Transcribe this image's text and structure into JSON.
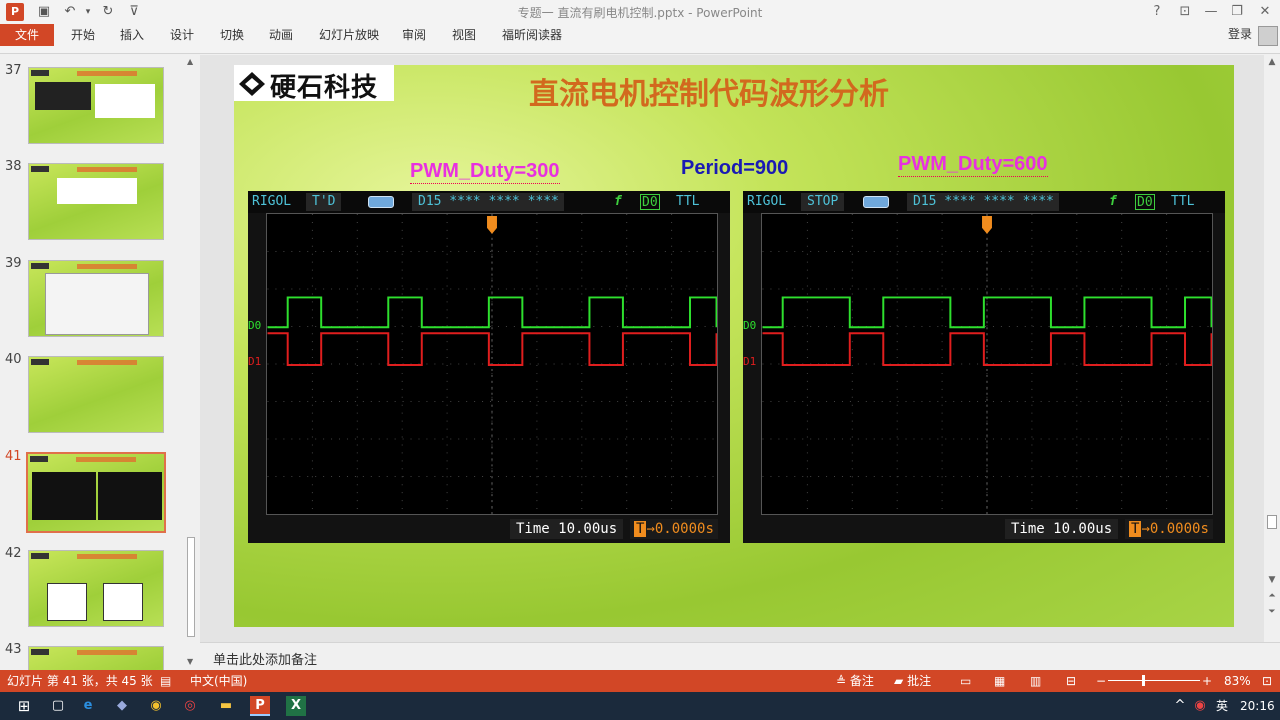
{
  "window": {
    "title": "专题一 直流有刷电机控制.pptx - PowerPoint",
    "quick_access": [
      "save-icon",
      "undo-icon",
      "redo-icon",
      "customize-icon"
    ],
    "controls": [
      "?",
      "⊡",
      "—",
      "❐",
      "✕"
    ]
  },
  "ribbon": {
    "file_tab": "文件",
    "tabs": [
      "开始",
      "插入",
      "设计",
      "切换",
      "动画",
      "幻灯片放映",
      "审阅",
      "视图",
      "福昕阅读器"
    ],
    "login": "登录"
  },
  "thumbnails": {
    "numbers": [
      "37",
      "38",
      "39",
      "40",
      "41",
      "42",
      "43"
    ],
    "active": "41"
  },
  "slide": {
    "logo_text": "硬石科技",
    "title": "直流电机控制代码波形分析",
    "duty_left": "PWM_Duty=300",
    "period": "Period=900",
    "duty_right": "PWM_Duty=600"
  },
  "scopes": [
    {
      "brand": "RIGOL",
      "mode": "T'D",
      "channels": "D15 **** **** **** D0",
      "edge": "f",
      "source": "D0",
      "level": "TTL",
      "time": "Time 10.00us",
      "offset": "0.0000s",
      "ch0": "D0",
      "ch1": "D1",
      "duty_fraction": 0.333,
      "period_divs": 2.24,
      "phase_divs": 0.45
    },
    {
      "brand": "RIGOL",
      "mode": "STOP",
      "channels": "D15 **** **** **** D0",
      "edge": "f",
      "source": "D0",
      "level": "TTL",
      "time": "Time 10.00us",
      "offset": "0.0000s",
      "ch0": "D0",
      "ch1": "D1",
      "duty_fraction": 0.667,
      "period_divs": 2.24,
      "phase_divs": 0.45
    }
  ],
  "notes": {
    "placeholder": "单击此处添加备注"
  },
  "status": {
    "slide_info": "幻灯片 第 41 张，共 45 张",
    "language": "中文(中国)",
    "notes_btn": "备注",
    "comments_btn": "批注",
    "zoom": "83%"
  },
  "taskbar": {
    "ime": "英",
    "time": "20:16"
  },
  "colors": {
    "accent": "#d24726",
    "d0": "#2ee02e",
    "d1": "#e01e1e",
    "title": "#d2691e",
    "duty": "#e830e0",
    "period": "#1a1ab4"
  }
}
